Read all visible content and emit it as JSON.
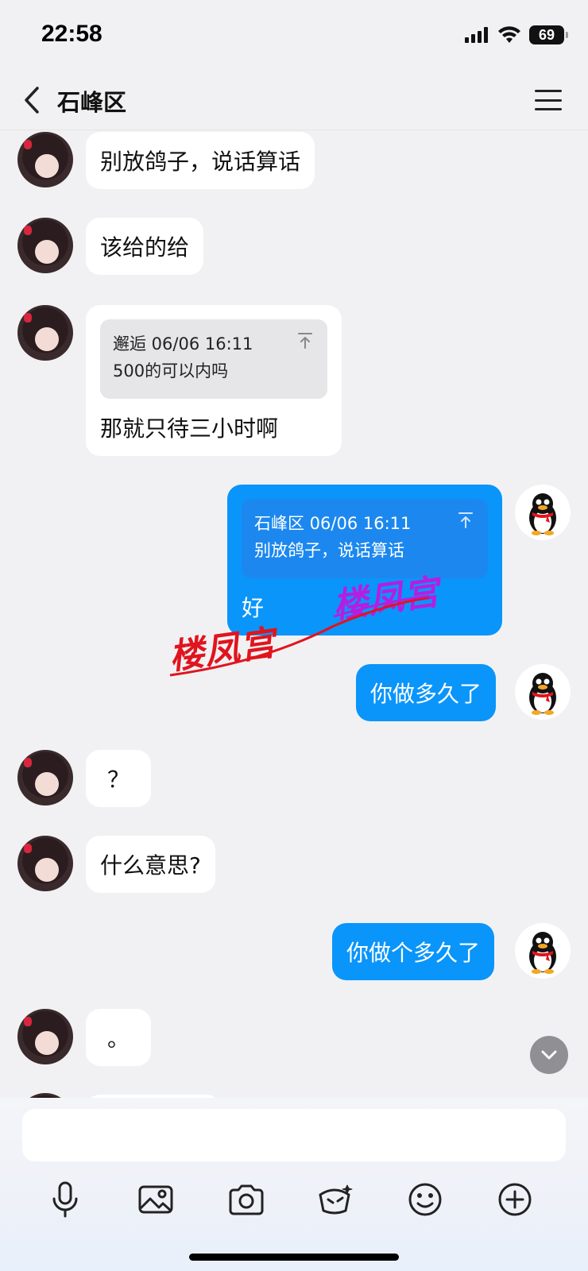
{
  "status_bar": {
    "time": "22:58",
    "battery": "69"
  },
  "header": {
    "title": "石峰区"
  },
  "messages": [
    {
      "side": "left",
      "text": "别放鸽子，说话算话"
    },
    {
      "side": "left",
      "text": "该给的给"
    },
    {
      "side": "left",
      "quote": {
        "meta": "邂逅 06/06 16:11",
        "text": "500的可以内吗"
      },
      "text": "那就只待三小时啊"
    },
    {
      "side": "right",
      "quote": {
        "meta": "石峰区 06/06 16:11",
        "text": "别放鸽子，说话算话"
      },
      "text": "好"
    },
    {
      "side": "right",
      "text": "你做多久了"
    },
    {
      "side": "left",
      "text": "？"
    },
    {
      "side": "left",
      "text": "什么意思?"
    },
    {
      "side": "right",
      "text": "你做个多久了"
    },
    {
      "side": "left",
      "text": "。"
    }
  ],
  "watermarks": [
    "楼凤宫",
    "楼凤宫"
  ],
  "colors": {
    "accent": "#0a95fa",
    "background": "#f1f1f3",
    "watermark_red": "#e0141e",
    "watermark_purple": "#b51ee0"
  },
  "toolbar": {
    "icons": [
      "microphone-icon",
      "image-icon",
      "camera-icon",
      "red-packet-icon",
      "emoji-icon",
      "plus-icon"
    ]
  }
}
